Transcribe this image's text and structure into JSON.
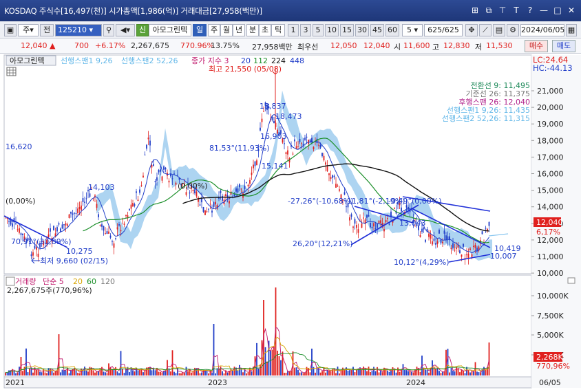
{
  "titlebar": {
    "title": "KOSDAQ 주식수[16,497(천)] 시가총액[1,986(억)] 거래대금[27,958(백만)]",
    "buttons": [
      "⊞",
      "⧉",
      "⊤",
      "T",
      "?",
      "—",
      "□",
      "✕"
    ]
  },
  "toolbar": {
    "period_type": "주",
    "prev_label": "전",
    "code": "125210",
    "stock_name": "아모그린텍",
    "stock_tag": "신",
    "periods": [
      "일",
      "주",
      "월",
      "년",
      "분",
      "초",
      "틱"
    ],
    "active_period": "일",
    "intervals": [
      "1",
      "3",
      "5",
      "10",
      "15",
      "30",
      "45",
      "60"
    ],
    "interval_select": "5",
    "count": "625/625",
    "date": "2024/06/05"
  },
  "quote": {
    "price": "12,040",
    "change": "700",
    "change_pct": "+6.17%",
    "volume": "2,267,675",
    "volume_pct": "770.96%",
    "turnover": "13.75%",
    "amount": "27,958백만",
    "best_label": "최우선",
    "best_ask": "12,050",
    "best_bid": "12,040",
    "open_label": "시",
    "open": "11,600",
    "high_label": "고",
    "high": "12,830",
    "low_label": "저",
    "low": "11,530",
    "buy_label": "매수",
    "sell_label": "매도"
  },
  "price_panel": {
    "legend_name": "아모그린텍",
    "legend_items": [
      {
        "text": "선행스팬1 9,26",
        "color": "#62b7e8"
      },
      {
        "text": "선행스팬2 52,26",
        "color": "#62b7e8"
      },
      {
        "text": "종가 지수 3",
        "color": "#c0186c"
      },
      {
        "text": "20",
        "color": "#1f3cc8"
      },
      {
        "text": "112",
        "color": "#1c8f2a"
      },
      {
        "text": "224",
        "color": "#111111"
      },
      {
        "text": "448",
        "color": "#1f3cc8"
      }
    ],
    "right_labels": {
      "lc": "LC:24.64",
      "hc": "HC:-44.13"
    },
    "ichimoku_values": [
      {
        "text": "전환선 9: 11,495",
        "color": "#1f8a5a"
      },
      {
        "text": "기준선 26: 11,375",
        "color": "#777777"
      },
      {
        "text": "후행스팬 26: 12,040",
        "color": "#b0208a"
      },
      {
        "text": "선행스팬1 9,26: 11,435",
        "color": "#62b7e8"
      },
      {
        "text": "선행스팬2 52,26: 11,315",
        "color": "#62b7e8"
      }
    ],
    "annotations": {
      "high_mark": "최고 21,550 (05/08)",
      "low_mark": "최저 9,660 (02/15)",
      "angle_1": "81,53°(11,93%)",
      "angle_2": "-27,26°(-10,68%)",
      "angle_3": "-11,81°(-2,19%)",
      "angle_4": "-0,49°(0,00%)",
      "angle_5": "26,20°(12,21%)",
      "angle_6": "10,12°(4,29%)",
      "angle_7": "70,91°(30,89%)",
      "left_value": "16,620",
      "left_zero": "(0,00%)",
      "mid_zero": "(0,00%)",
      "val_14103": "14,103",
      "val_10275": "10,275",
      "val_18837": "18,837",
      "val_18473": "18,473",
      "val_16903": "16,903",
      "val_15141": "15,141",
      "val_13043": "13,043",
      "val_10419": "10,419",
      "val_10007": "10,007"
    },
    "y_ticks": [
      "21,000",
      "20,000",
      "19,000",
      "18,000",
      "17,000",
      "16,000",
      "15,000",
      "14,000",
      "13,000",
      "12,000",
      "11,000",
      "10,000"
    ],
    "price_tag": "12,040",
    "pct_tag": "6,17%"
  },
  "volume_panel": {
    "legend": "거래량",
    "legend_sma": "단순 5",
    "legend_ma": [
      "20",
      "60",
      "120"
    ],
    "ma_colors": [
      "#c0186c",
      "#d8a500",
      "#1c8f2a",
      "#777777"
    ],
    "summary": "2,267,675주(770,96%)",
    "y_ticks": [
      "10,000K",
      "7,500K",
      "5,000K",
      "2,500K"
    ],
    "vol_tag": "2,268K",
    "pct_tag": "770,96%"
  },
  "x_axis": {
    "labels": [
      "2021",
      "2023",
      "2024"
    ],
    "last": "06/05"
  }
}
